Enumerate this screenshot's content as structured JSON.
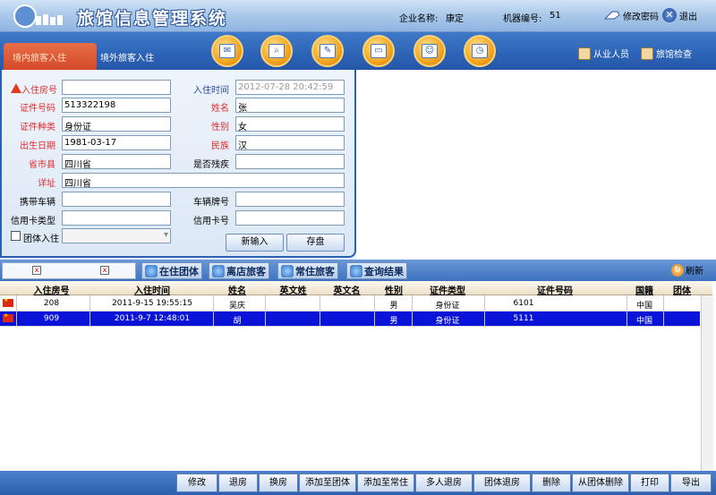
{
  "header": {
    "title": "旅馆信息管理系统",
    "company_label": "企业名称:",
    "company_name": "康定",
    "machine_label": "机器编号:",
    "machine_no": "51",
    "change_password": "修改密码",
    "logout": "退出"
  },
  "toolbar": {
    "tab_domestic": "境内旅客入住",
    "tab_foreign": "境外旅客入住",
    "icons": [
      "mail-icon",
      "search-icon",
      "edit-icon",
      "monitor-icon",
      "user-icon",
      "clock-icon"
    ],
    "staff": "从业人员",
    "inspect": "旅馆检查"
  },
  "form": {
    "room_no_label": "入住房号",
    "room_no_value": "",
    "checkin_time_label": "入住时间",
    "checkin_time_value": "2012-07-28 20:42:59",
    "id_no_label": "证件号码",
    "id_no_value": "513322198",
    "name_label": "姓名",
    "name_value": "张",
    "id_type_label": "证件种类",
    "id_type_value": "身份证",
    "gender_label": "性别",
    "gender_value": "女",
    "birth_label": "出生日期",
    "birth_value": "1981-03-17",
    "ethnic_label": "民族",
    "ethnic_value": "汉",
    "province_label": "省市县",
    "province_value": "四川省",
    "disabled_label": "是否残疾",
    "disabled_value": "",
    "address_label": "详址",
    "address_value": "四川省",
    "vehicle_label": "携带车辆",
    "vehicle_value": "",
    "plate_label": "车辆牌号",
    "plate_value": "",
    "card_type_label": "信用卡类型",
    "card_type_value": "",
    "card_no_label": "信用卡号",
    "card_no_value": "",
    "group_label": "团体入住",
    "new_button": "新输入",
    "save_button": "存盘"
  },
  "subtabs": {
    "in_group": "在住团体",
    "left_guests": "离店旅客",
    "staying_guests": "常住旅客",
    "query_results": "查询结果",
    "refresh": "刷新"
  },
  "table": {
    "headers": [
      "入住房号",
      "入住时间",
      "姓名",
      "英文姓",
      "英文名",
      "性别",
      "证件类型",
      "证件号码",
      "国籍",
      "团体"
    ],
    "rows": [
      {
        "room": "208",
        "time": "2011-9-15 19:55:15",
        "name": "吴庆",
        "en_last": "",
        "en_first": "",
        "gender": "男",
        "id_type": "身份证",
        "id_no": "6101",
        "nation": "中国",
        "group": ""
      },
      {
        "room": "909",
        "time": "2011-9-7 12:48:01",
        "name": "胡",
        "en_last": "",
        "en_first": "",
        "gender": "男",
        "id_type": "身份证",
        "id_no": "5111",
        "nation": "中国",
        "group": ""
      }
    ]
  },
  "bottom": {
    "buttons": [
      "修改",
      "退房",
      "换房",
      "添加至团体",
      "添加至常住",
      "多人退房",
      "团体退房",
      "删除",
      "从团体删除",
      "打印",
      "导出"
    ]
  }
}
